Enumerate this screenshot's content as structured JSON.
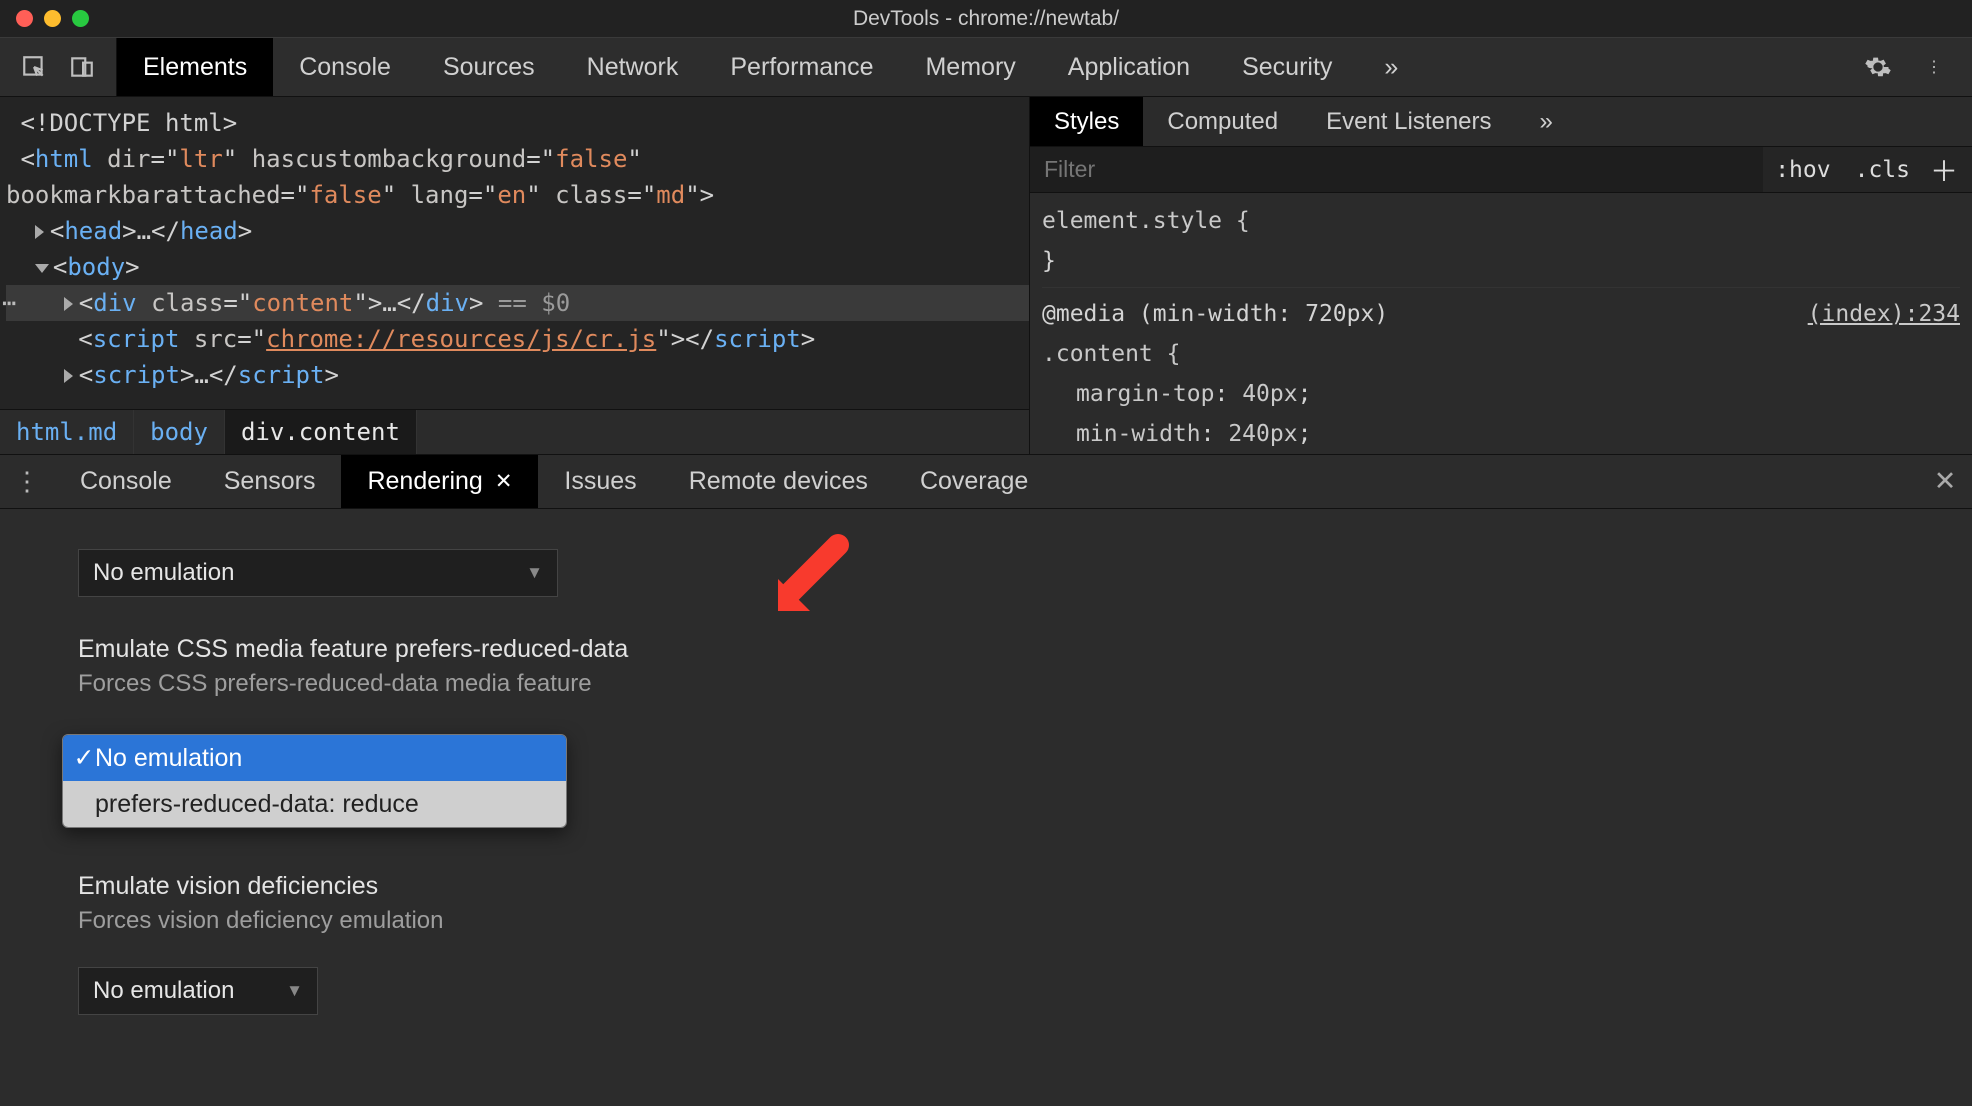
{
  "window": {
    "title": "DevTools - chrome://newtab/"
  },
  "tabs": {
    "elements": "Elements",
    "console": "Console",
    "sources": "Sources",
    "network": "Network",
    "performance": "Performance",
    "memory": "Memory",
    "application": "Application",
    "security": "Security"
  },
  "dom": {
    "doctype": "<!DOCTYPE html>",
    "html_open_1": "<html dir=\"ltr\" hascustombackground=\"false\"",
    "html_open_2": "bookmarkbarattached=\"false\" lang=\"en\" class=\"md\">",
    "head": "<head>…</head>",
    "body": "<body>",
    "content": "<div class=\"content\">…</div>",
    "eq0": "== $0",
    "script1": "<script src=\"chrome://resources/js/cr.js\"></scr",
    "script2": "<script>…</scr"
  },
  "breadcrumb": [
    "html.md",
    "body",
    "div.content"
  ],
  "styles": {
    "tabs": {
      "styles": "Styles",
      "computed": "Computed",
      "events": "Event Listeners"
    },
    "filter_placeholder": "Filter",
    "hov": ":hov",
    "cls": ".cls",
    "element_style": "element.style {",
    "brace_close": "}",
    "media": "@media (min-width: 720px)",
    "selector": ".content {",
    "rule1": "margin-top: 40px;",
    "rule2": "min-width: 240px;",
    "source_link": "(index):234"
  },
  "drawer": {
    "tabs": {
      "console": "Console",
      "sensors": "Sensors",
      "rendering": "Rendering",
      "issues": "Issues",
      "remote": "Remote devices",
      "coverage": "Coverage"
    }
  },
  "rendering": {
    "top_select": "No emulation",
    "prefers_title": "Emulate CSS media feature prefers-reduced-data",
    "prefers_desc": "Forces CSS prefers-reduced-data media feature",
    "menu_opt_1": "No emulation",
    "menu_opt_2": "prefers-reduced-data: reduce",
    "vision_title": "Emulate vision deficiencies",
    "vision_desc": "Forces vision deficiency emulation",
    "vision_select": "No emulation"
  }
}
